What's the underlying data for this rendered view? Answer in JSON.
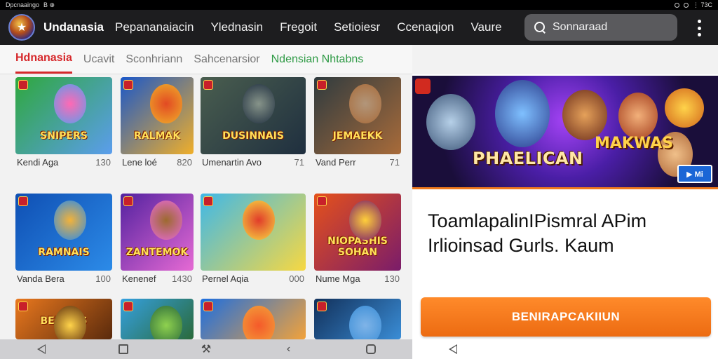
{
  "status": {
    "left_text": "Dpcnaaingo",
    "left_icons": "B  ⊕",
    "right_text": "⋮ 73C"
  },
  "nav": {
    "brand": "Undanasia",
    "links": [
      "Pepananaiacin",
      "Ylednasin",
      "Fregoit",
      "Setioiesr",
      "Ccenaqion",
      "Vaure"
    ],
    "search_placeholder": "Sonnaraad"
  },
  "tabs": [
    "Hdnanasia",
    "Ucavit",
    "Sconhriann",
    "Sahcenarsior",
    "Ndensian Nhtabns"
  ],
  "games": [
    {
      "title": "SNIPERS",
      "name": "Kendi Aga",
      "count": "130",
      "bg": [
        "#2fa83d",
        "#5b9ded"
      ],
      "tone": "#ff69b4"
    },
    {
      "title": "RALMAK",
      "name": "Lene loé",
      "count": "820",
      "bg": [
        "#1a57c9",
        "#f0af2a"
      ],
      "tone": "#e24a23"
    },
    {
      "title": "DUSINNAIS",
      "name": "Umenartin Avo",
      "count": "71",
      "bg": [
        "#4a5e4f",
        "#1f2f3f"
      ],
      "tone": "#87948a"
    },
    {
      "title": "JEMAEKK",
      "name": "Vand Perr",
      "count": "71",
      "bg": [
        "#2f3b3f",
        "#a86b3a"
      ],
      "tone": "#b2967a"
    },
    {
      "title": "RAMNAIS",
      "name": "Vanda Bera",
      "count": "100",
      "bg": [
        "#0f4fb3",
        "#2c8be8"
      ],
      "tone": "#f2b23a"
    },
    {
      "title": "ZANTEMOK",
      "name": "Kenenef",
      "count": "1430",
      "bg": [
        "#5322a0",
        "#e66ad4"
      ],
      "tone": "#9d6a2f"
    },
    {
      "title": "",
      "name": "Pernel Aqia",
      "count": "000",
      "bg": [
        "#3fb8e8",
        "#f7d842"
      ],
      "tone": "#e13c2a"
    },
    {
      "title": "NIOPASHIS SOHAN",
      "name": "Nume Mga",
      "count": "130",
      "bg": [
        "#e5511b",
        "#7a1c6a"
      ],
      "tone": "#ffcf3a"
    },
    {
      "title": "BEILNAS",
      "name": "",
      "count": "",
      "bg": [
        "#e9781e",
        "#5a2a0c"
      ],
      "tone": "#ffd34a"
    },
    {
      "title": "",
      "name": "",
      "count": "",
      "bg": [
        "#35a0e0",
        "#2a6a3a"
      ],
      "tone": "#8fd14f"
    },
    {
      "title": "",
      "name": "",
      "count": "",
      "bg": [
        "#1c6ee0",
        "#f2a23a"
      ],
      "tone": "#f55a2a"
    },
    {
      "title": "",
      "name": "",
      "count": "",
      "bg": [
        "#12305a",
        "#3a8dd6"
      ],
      "tone": "#7fb4e8"
    }
  ],
  "promo": {
    "banner_title": "PHAELICAN",
    "banner_title2": "MAKWAS",
    "banner_tag": "▶ Mi",
    "headline": "ToamlapalinIPismral APim Irlioinsad Gurls. Kaum",
    "cta_label": "BENIRAPCAKIIUN"
  },
  "bottom_nav": [
    "back",
    "home",
    "assist",
    "chevron",
    "recents"
  ],
  "colors": {
    "accent": "#d6282b",
    "cta": "#f07a1d",
    "nav_bg": "#1d1d1f",
    "green_tab": "#2e9a45"
  }
}
